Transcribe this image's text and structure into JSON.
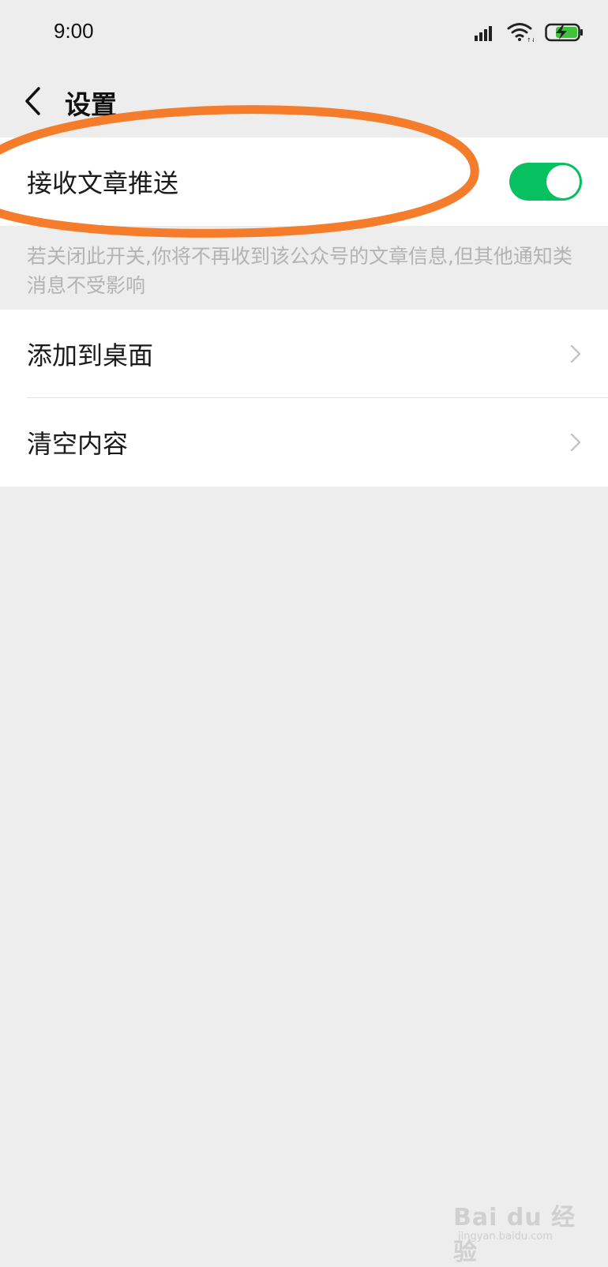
{
  "status_bar": {
    "time": "9:00",
    "icons": [
      "signal-icon",
      "wifi-icon",
      "battery-charging-icon"
    ]
  },
  "nav": {
    "title": "设置",
    "back_icon": "chevron-left-icon"
  },
  "push_setting": {
    "label": "接收文章推送",
    "enabled": true,
    "hint": "若关闭此开关,你将不再收到该公众号的文章信息,但其他通知类消息不受影响"
  },
  "menu": {
    "items": [
      {
        "label": "添加到桌面",
        "icon": "chevron-right-icon"
      },
      {
        "label": "清空内容",
        "icon": "chevron-right-icon"
      }
    ]
  },
  "colors": {
    "toggle_on": "#07c160",
    "annotation": "#f47c2a",
    "background": "#ededed"
  },
  "watermark": {
    "text": "Bai du 经验",
    "sub": "jingyan.baidu.com"
  }
}
